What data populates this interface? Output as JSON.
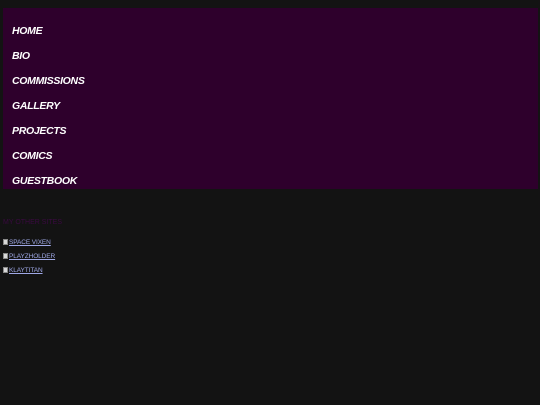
{
  "nav": {
    "items": [
      {
        "label": "HOME"
      },
      {
        "label": "BIO"
      },
      {
        "label": "COMMISSIONS"
      },
      {
        "label": "GALLERY"
      },
      {
        "label": "PROJECTS"
      },
      {
        "label": "COMICS"
      },
      {
        "label": "GUESTBOOK"
      }
    ]
  },
  "links_section": {
    "heading": "MY OTHER SITES",
    "links": [
      {
        "label": "SPACE VIXEN"
      },
      {
        "label": "PLAYZHOLDER"
      },
      {
        "label": "KLAYTITAN"
      }
    ]
  },
  "colors": {
    "page_background": "#131313",
    "nav_background": "#2e002c",
    "nav_text": "#ffffff",
    "link_text": "#9fa8e6"
  }
}
